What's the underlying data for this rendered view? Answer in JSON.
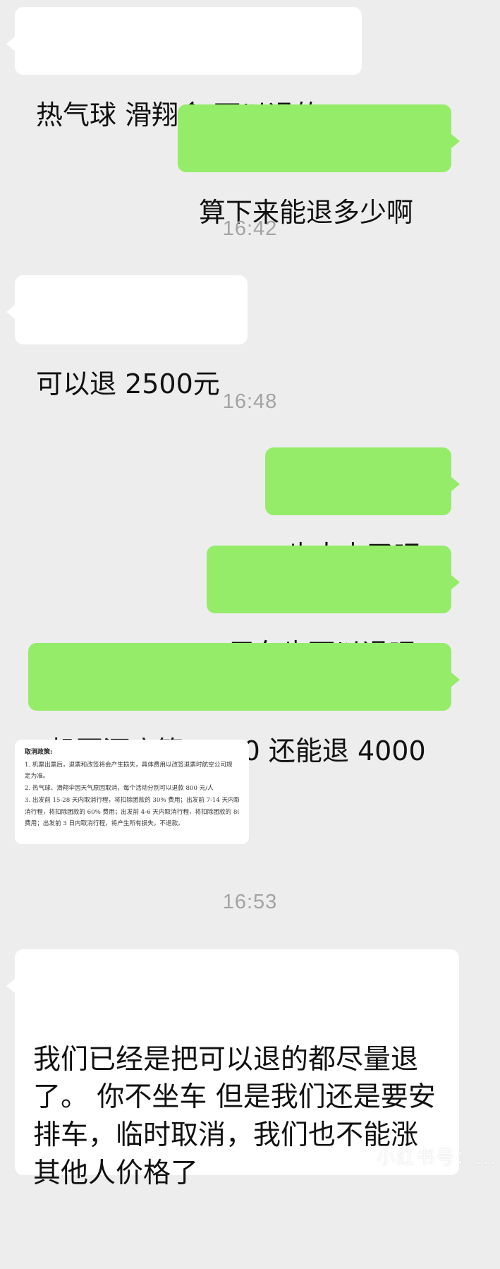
{
  "messages": [
    {
      "side": "in",
      "text": "热气球 滑翔伞 可以退的"
    },
    {
      "side": "out",
      "text": "算下来能退多少啊"
    },
    {
      "time": "16:42"
    },
    {
      "side": "in",
      "text": "可以退 2500元"
    },
    {
      "time": "16:48"
    },
    {
      "side": "out",
      "text": "也太少了吧"
    },
    {
      "side": "out",
      "text": "用车也可以退吧"
    },
    {
      "side": "out",
      "text": "机票酒店算 4500 还能退 4000"
    },
    {
      "doc": true
    },
    {
      "time": "16:53"
    },
    {
      "side": "in",
      "text": "我们已经是把可以退的都尽量退了。 你不坐车 但是我们还是要安排车，临时取消，我们也不能涨其他人价格了"
    }
  ],
  "document_image": {
    "title": "取消政策:",
    "lines": [
      "1. 机票出票后，退票和改签将会产生损失，具体费用以改签退票时航空公司规",
      "定为准。",
      "2. 热气球、滑翔伞因天气原因取消，每个活动分别可以退款 800 元/人",
      "3. 出发前 15-28 天内取消行程，将扣除团款的 30% 费用；出发前 7-14 天内取",
      "消行程，将扣除团款的 60% 费用；出发前 4-6 天内取消行程，将扣除团款的 80%",
      "费用；出发前 3 日内取消行程，将产生所有损失，不退款。"
    ]
  },
  "watermark": "小红书号：..."
}
